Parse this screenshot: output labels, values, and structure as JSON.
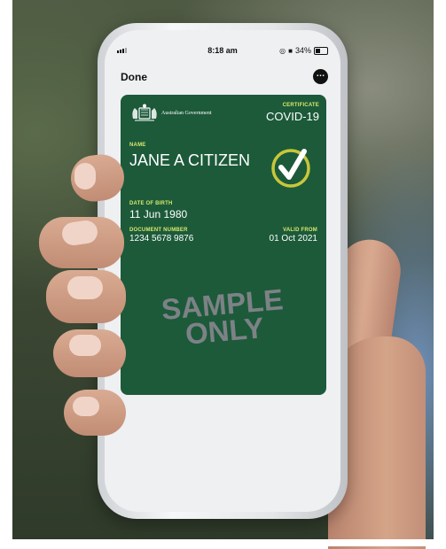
{
  "status_bar": {
    "time": "8:18 am",
    "battery": "34%",
    "icons": [
      "signal-icon",
      "location-icon",
      "lock-rotation-icon",
      "battery-icon"
    ]
  },
  "nav": {
    "done_label": "Done",
    "more_icon": "more-icon"
  },
  "certificate": {
    "issuer": "Australian Government",
    "type_label": "CERTIFICATE",
    "type_value": "COVID-19",
    "name_label": "NAME",
    "name_value": "JANE A CITIZEN",
    "dob_label": "DATE OF BIRTH",
    "dob_value": "11 Jun 1980",
    "doc_label": "DOCUMENT NUMBER",
    "doc_value": "1234 5678 9876",
    "valid_label": "VALID FROM",
    "valid_value": "01 Oct 2021",
    "watermark_line1": "SAMPLE",
    "watermark_line2": "ONLY",
    "check_icon": "verified-check-icon"
  },
  "colors": {
    "card": "#1c5a3a",
    "label_accent": "#d8e86a",
    "check_ring": "#c9c63a"
  }
}
